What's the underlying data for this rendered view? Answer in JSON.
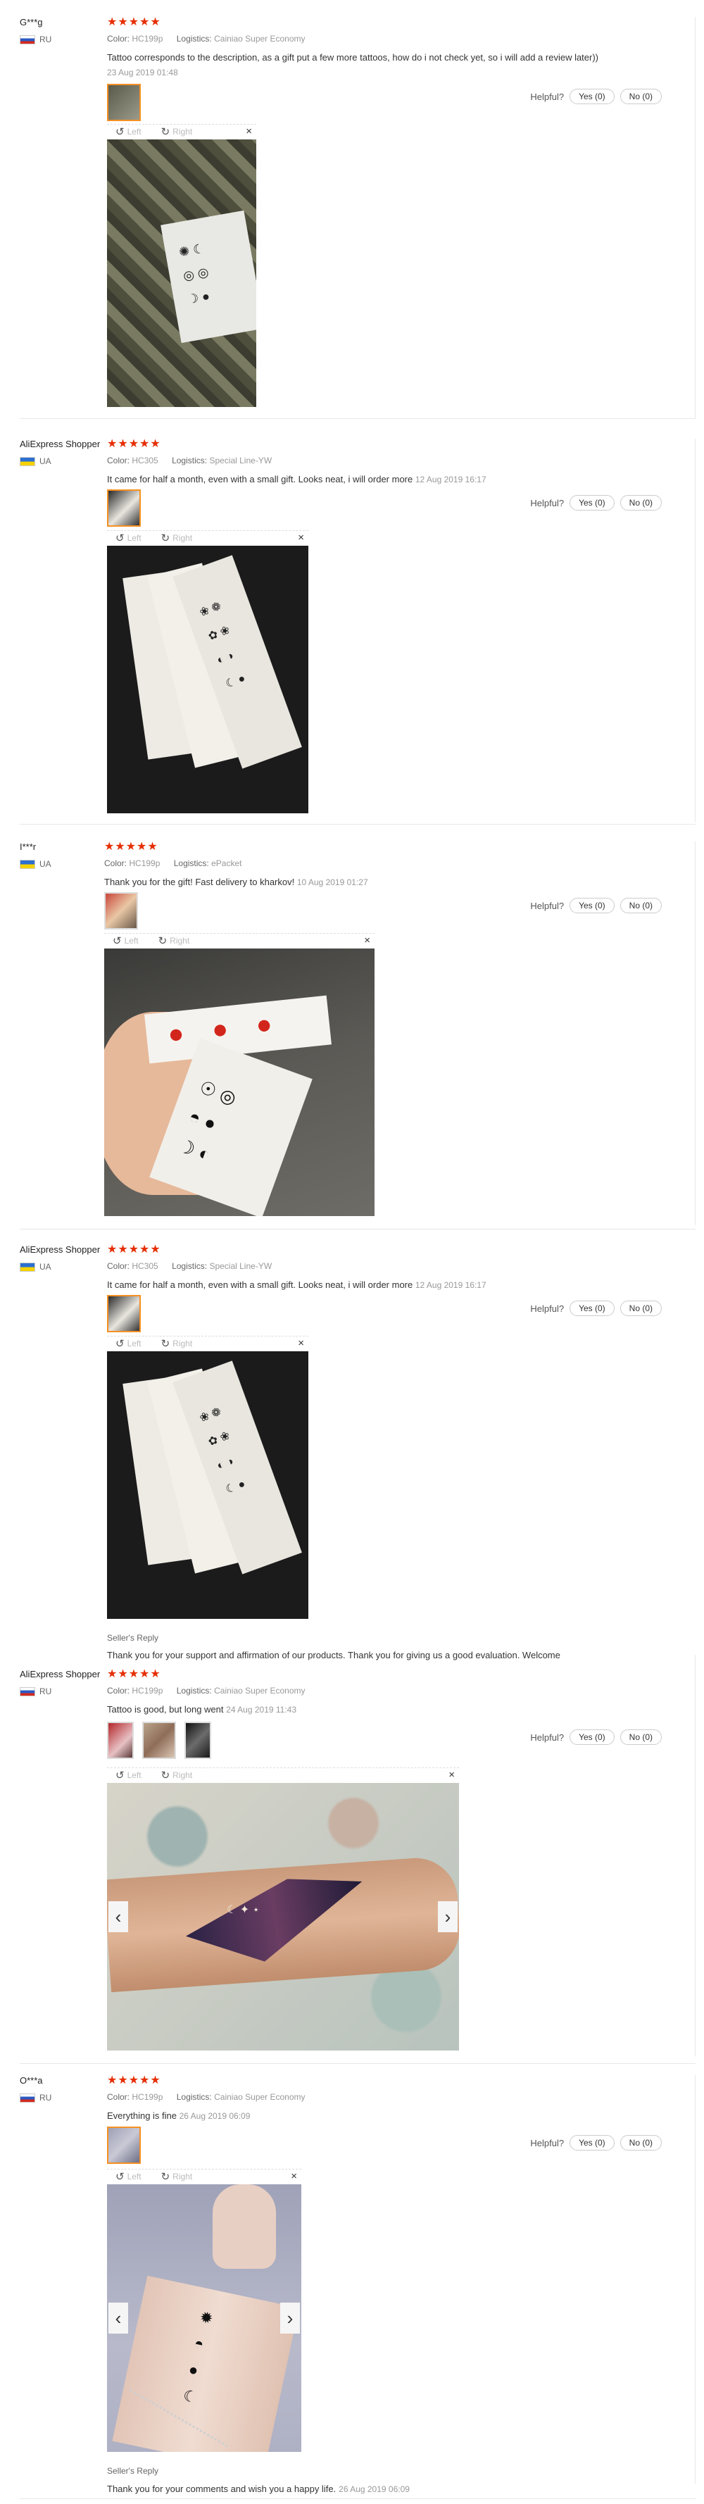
{
  "labels": {
    "color": "Color:",
    "logistics": "Logistics:",
    "helpful": "Helpful?",
    "yes": "Yes (0)",
    "no": "No (0)",
    "left": "Left",
    "right": "Right",
    "close": "×",
    "seller_reply": "Seller's Reply",
    "rotate_left_glyph": "↺",
    "rotate_right_glyph": "↻",
    "prev_glyph": "‹",
    "next_glyph": "›"
  },
  "colors": {
    "star": "#e62e04",
    "selected_thumb": "#f59023"
  },
  "reviews": [
    {
      "user": "G***g",
      "country": "RU",
      "stars": "★★★★★",
      "color": "HC199p",
      "logistics": "Cainiao Super Economy",
      "text": "Tattoo corresponds to the description, as a gift put a few more tattoos, how do i not check yet, so i will add a review later))",
      "date": "23 Aug 2019 01:48"
    },
    {
      "user": "AliExpress Shopper",
      "country": "UA",
      "stars": "★★★★★",
      "color": "HC305",
      "logistics": "Special Line-YW",
      "text": "It came for half a month, even with a small gift. Looks neat, i will order more",
      "date": "12 Aug 2019 16:17"
    },
    {
      "user": "I***r",
      "country": "UA",
      "stars": "★★★★★",
      "color": "HC199p",
      "logistics": "ePacket",
      "text": "Thank you for the gift! Fast delivery to kharkov!",
      "date": "10 Aug 2019 01:27"
    },
    {
      "user": "AliExpress Shopper",
      "country": "UA",
      "stars": "★★★★★",
      "color": "HC305",
      "logistics": "Special Line-YW",
      "text": "It came for half a month, even with a small gift. Looks neat, i will order more",
      "date": "12 Aug 2019 16:17",
      "seller_reply": "Thank you for your support and affirmation of our products. Thank you for giving us a good evaluation. Welcome"
    },
    {
      "user": "AliExpress Shopper",
      "country": "RU",
      "stars": "★★★★★",
      "color": "HC199p",
      "logistics": "Cainiao Super Economy",
      "text": "Tattoo is good, but long went",
      "date": "24 Aug 2019 11:43"
    },
    {
      "user": "O***a",
      "country": "RU",
      "stars": "★★★★★",
      "color": "HC199p",
      "logistics": "Cainiao Super Economy",
      "text": "Everything is fine",
      "date": "26 Aug 2019 06:09",
      "seller_reply": "Thank you for your comments and wish you a happy life.",
      "seller_reply_date": "26 Aug 2019 06:09"
    }
  ]
}
